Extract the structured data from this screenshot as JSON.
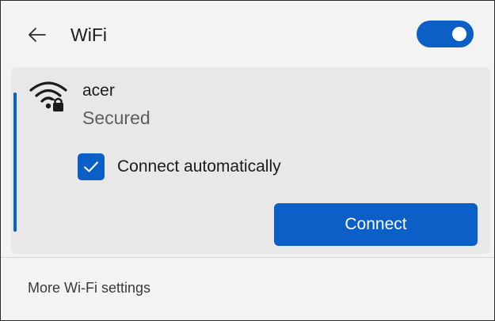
{
  "header": {
    "back_icon": "arrow-left-icon",
    "title": "WiFi",
    "toggle_state": "on"
  },
  "network": {
    "icon": "wifi-secured-icon",
    "name": "acer",
    "status": "Secured",
    "connect_automatically": {
      "label": "Connect automatically",
      "checked": true
    },
    "connect_label": "Connect"
  },
  "footer": {
    "more_settings_label": "More Wi-Fi settings"
  },
  "colors": {
    "accent": "#0b5fc7",
    "panel_background": "#f3f3f3",
    "card_background": "#e8e8e8",
    "secondary_text": "#5e5e5e"
  }
}
